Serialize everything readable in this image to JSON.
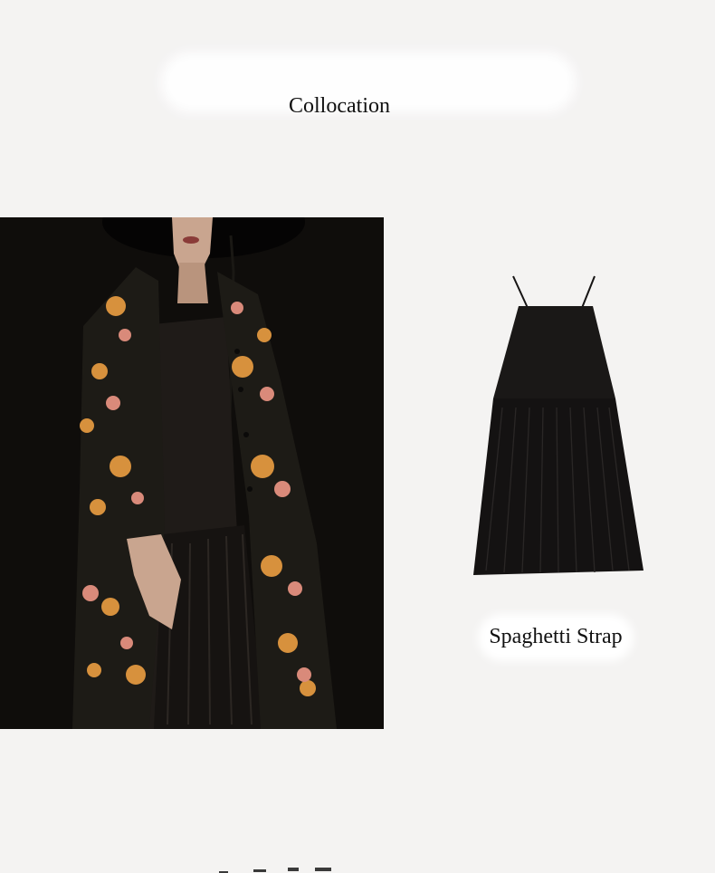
{
  "heading": "Collocation",
  "product_label": "Spaghetti Strap",
  "colors": {
    "page_bg": "#f4f3f2",
    "dress": "#141212",
    "coat_base": "#1b1915",
    "flower_orange": "#d7913d",
    "flower_pink": "#d98a7a"
  },
  "images": {
    "model_photo": "model-in-floral-coat-and-black-dress",
    "product_photo": "black-spaghetti-strap-pleated-dress"
  }
}
